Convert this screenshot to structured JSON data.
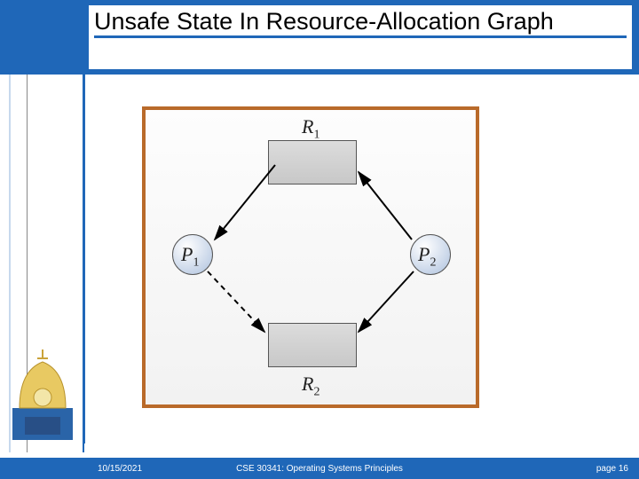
{
  "header": {
    "title": "Unsafe State In Resource-Allocation Graph"
  },
  "figure": {
    "r1": "R",
    "r1sub": "1",
    "r2": "R",
    "r2sub": "2",
    "p1": "P",
    "p1sub": "1",
    "p2": "P",
    "p2sub": "2"
  },
  "footer": {
    "date": "10/15/2021",
    "course": "CSE 30341: Operating Systems Principles",
    "page": "page 16"
  }
}
